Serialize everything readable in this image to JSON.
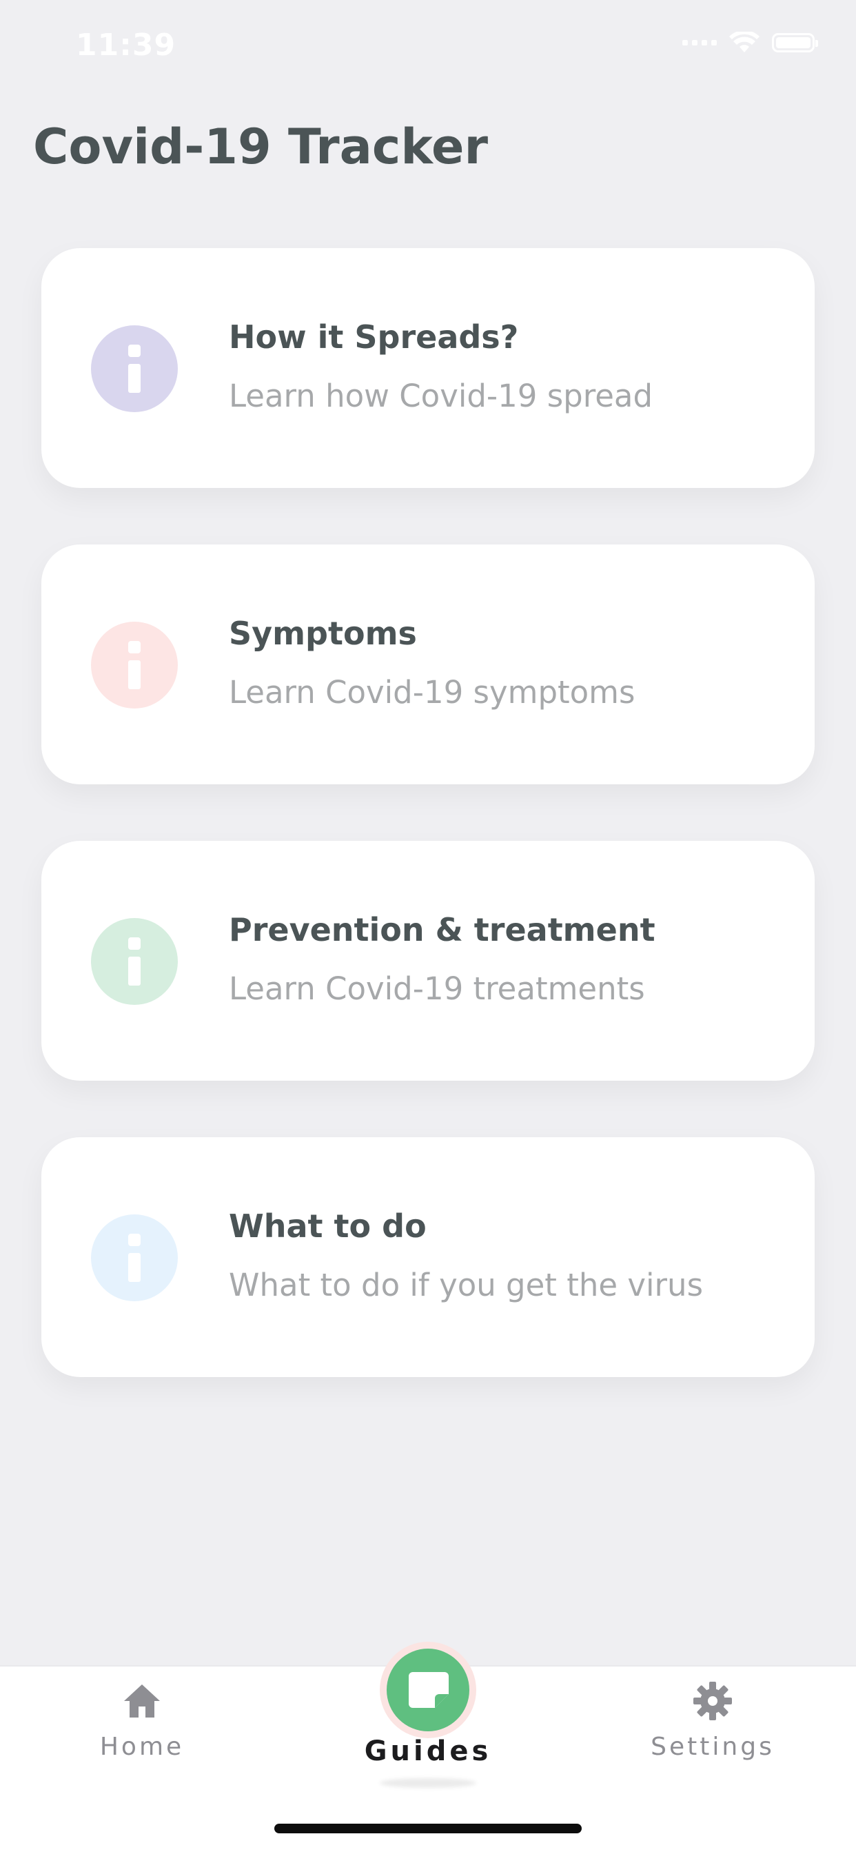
{
  "status_bar": {
    "time": "11:39"
  },
  "header": {
    "title": "Covid-19 Tracker"
  },
  "guides": [
    {
      "title": "How it Spreads?",
      "subtitle": "Learn how Covid-19 spread",
      "icon": "info-icon",
      "color": "#d9d6ee"
    },
    {
      "title": "Symptoms",
      "subtitle": "Learn Covid-19 symptoms",
      "icon": "info-icon",
      "color": "#fde5e4"
    },
    {
      "title": "Prevention & treatment",
      "subtitle": "Learn Covid-19 treatments",
      "icon": "info-icon",
      "color": "#d6eedf"
    },
    {
      "title": "What to do",
      "subtitle": "What to do if you get the virus",
      "icon": "info-icon",
      "color": "#e5f2fd"
    }
  ],
  "tab_bar": {
    "home_label": "Home",
    "guides_label": "Guides",
    "settings_label": "Settings",
    "active": "Guides",
    "accent_color": "#5fbf80"
  }
}
